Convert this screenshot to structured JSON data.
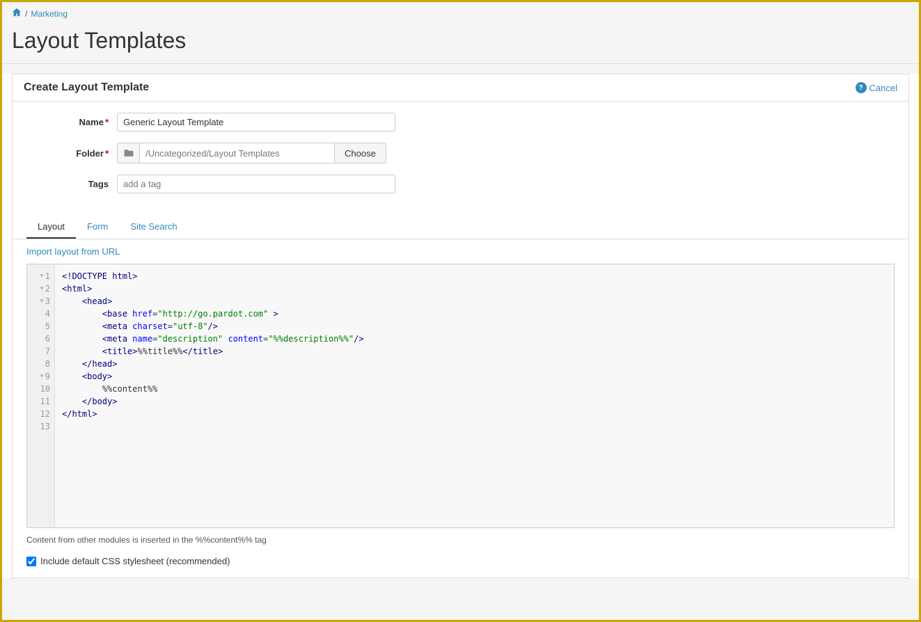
{
  "breadcrumb": {
    "home_label": "🏠",
    "separator": "/",
    "section_label": "Marketing"
  },
  "page": {
    "title": "Layout Templates"
  },
  "form": {
    "panel_title": "Create Layout Template",
    "cancel_label": "Cancel",
    "name_label": "Name",
    "name_value": "Generic Layout Template",
    "name_placeholder": "",
    "folder_label": "Folder",
    "folder_value": "/Uncategorized/Layout Templates",
    "choose_label": "Choose",
    "tags_label": "Tags",
    "tags_placeholder": "add a tag"
  },
  "tabs": [
    {
      "id": "layout",
      "label": "Layout",
      "active": true
    },
    {
      "id": "form",
      "label": "Form",
      "active": false
    },
    {
      "id": "site-search",
      "label": "Site Search",
      "active": false
    }
  ],
  "layout_section": {
    "import_link_label": "Import layout from URL"
  },
  "code_editor": {
    "lines": [
      {
        "num": 1,
        "collapsible": true,
        "text": "<!DOCTYPE html>"
      },
      {
        "num": 2,
        "collapsible": true,
        "text": "<html>"
      },
      {
        "num": 3,
        "collapsible": true,
        "text": "    <head>"
      },
      {
        "num": 4,
        "collapsible": false,
        "text": "        <base href=\"http://go.pardot.com\" >"
      },
      {
        "num": 5,
        "collapsible": false,
        "text": "        <meta charset=\"utf-8\"/>"
      },
      {
        "num": 6,
        "collapsible": false,
        "text": "        <meta name=\"description\" content=\"%%description%%\"/>"
      },
      {
        "num": 7,
        "collapsible": false,
        "text": "        <title>%%title%%</title>"
      },
      {
        "num": 8,
        "collapsible": false,
        "text": "    </head>"
      },
      {
        "num": 9,
        "collapsible": true,
        "text": "    <body>"
      },
      {
        "num": 10,
        "collapsible": false,
        "text": "        %%content%%"
      },
      {
        "num": 11,
        "collapsible": false,
        "text": "    </body>"
      },
      {
        "num": 12,
        "collapsible": false,
        "text": "</html>"
      },
      {
        "num": 13,
        "collapsible": false,
        "text": ""
      }
    ]
  },
  "footer": {
    "note": "Content from other modules is inserted in the %%content%% tag",
    "checkbox_label": "Include default CSS stylesheet (recommended)",
    "checkbox_checked": true
  }
}
